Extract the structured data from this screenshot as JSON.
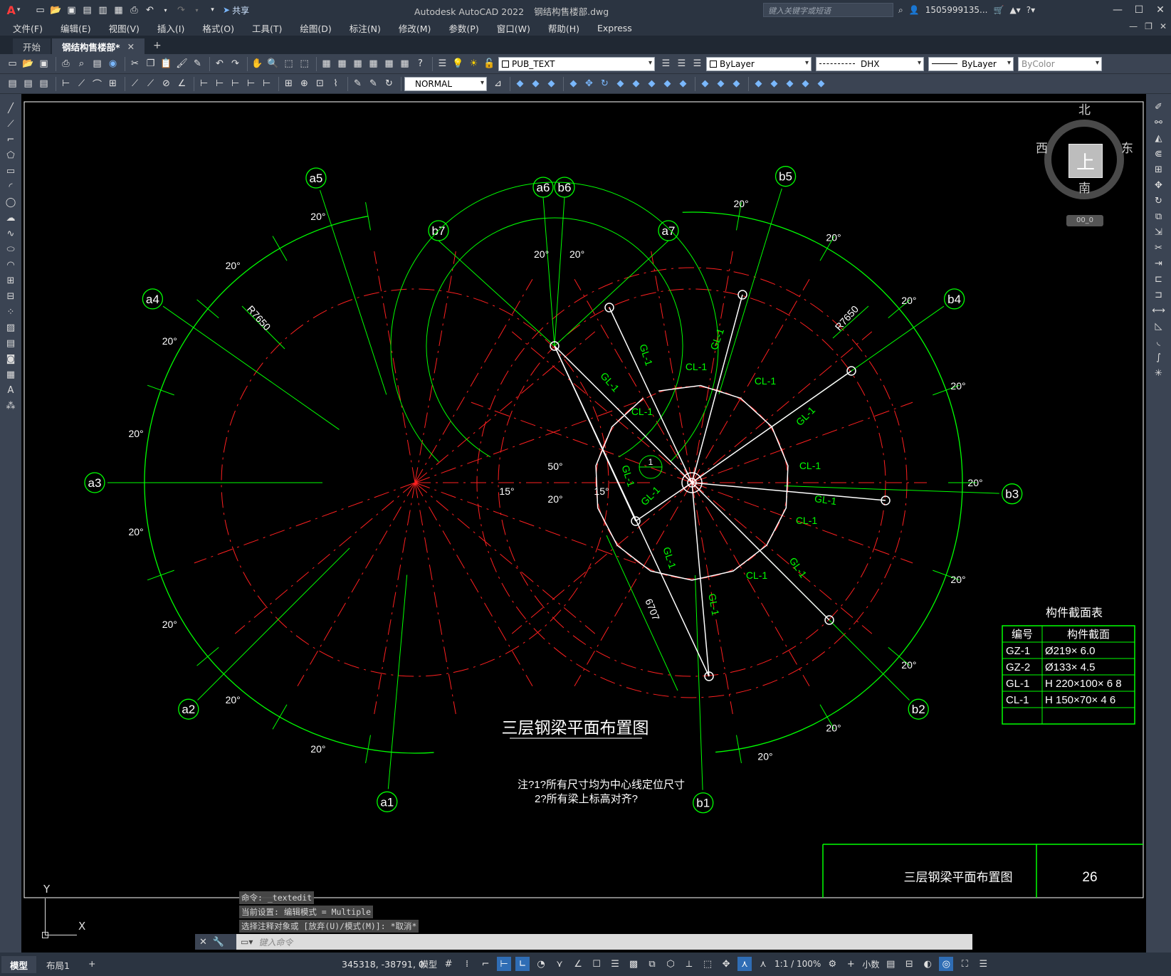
{
  "titlebar": {
    "logo": "A",
    "share_label": "共享",
    "app_title": "Autodesk AutoCAD 2022",
    "file_name": "钢结构售楼部.dwg",
    "search_placeholder": "键入关键字或短语",
    "user": "1505999135...",
    "icons": [
      "new-icon",
      "open-icon",
      "save-icon",
      "saveas-icon",
      "plot-icon",
      "undo-icon",
      "redo-icon",
      "share-icon",
      "search-icon",
      "user-icon",
      "cart-icon",
      "help-icon"
    ]
  },
  "menu": [
    "文件(F)",
    "编辑(E)",
    "视图(V)",
    "插入(I)",
    "格式(O)",
    "工具(T)",
    "绘图(D)",
    "标注(N)",
    "修改(M)",
    "参数(P)",
    "窗口(W)",
    "帮助(H)",
    "Express"
  ],
  "tabs": [
    {
      "label": "开始",
      "active": false
    },
    {
      "label": "钢结构售楼部*",
      "active": true
    }
  ],
  "toolbar": {
    "layer": "PUB_TEXT",
    "color": "ByLayer",
    "linetype": "DHX",
    "lineweight": "ByLayer",
    "plotstyle": "ByColor",
    "textstyle": "NORMAL"
  },
  "viewcube": {
    "north": "北",
    "south": "南",
    "east": "东",
    "west": "西",
    "face": "上",
    "wcs": "00_0"
  },
  "ucs": {
    "x": "X",
    "y": "Y"
  },
  "drawing": {
    "grid_labels": [
      "a1",
      "a2",
      "a3",
      "a4",
      "a5",
      "a6",
      "a7",
      "b1",
      "b2",
      "b3",
      "b4",
      "b5",
      "b6",
      "b7"
    ],
    "angle_label": "20°",
    "angle_50": "50°",
    "angle_15": "15°",
    "radius_label": "R7650",
    "dim_6707": "6707",
    "member_gl": "GL-1",
    "member_cl": "CL-1",
    "detail_no": "1",
    "title": "三层钢梁平面布置图",
    "note_1": "注?1?所有尺寸均为中心线定位尺寸",
    "note_2": "2?所有梁上标高对齐?",
    "table_title": "构件截面表",
    "table_headers": [
      "编号",
      "构件截面"
    ],
    "table_rows": [
      [
        "GZ-1",
        "Ø219×  6.0"
      ],
      [
        "GZ-2",
        "Ø133×  4.5"
      ],
      [
        "GL-1",
        "H 220×100× 6  8"
      ],
      [
        "CL-1",
        "H 150×70× 4  6"
      ]
    ],
    "titleblock_name": "三层钢梁平面布置图",
    "titleblock_number": "26"
  },
  "command": {
    "history": [
      "命令: _textedit",
      "当前设置: 编辑模式 = Multiple",
      "选择注释对象或 [放弃(U)/模式(M)]: *取消*"
    ],
    "placeholder": "键入命令"
  },
  "status": {
    "layouts": [
      {
        "label": "模型",
        "active": true
      },
      {
        "label": "布局1",
        "active": false
      }
    ],
    "coords": "345318, -38791, 0",
    "model": "模型",
    "scale": "1:1 / 100%",
    "units": "小数"
  },
  "colors": {
    "green": "#00ff00",
    "red": "#ff0000",
    "white": "#ffffff",
    "bg": "#000000"
  }
}
